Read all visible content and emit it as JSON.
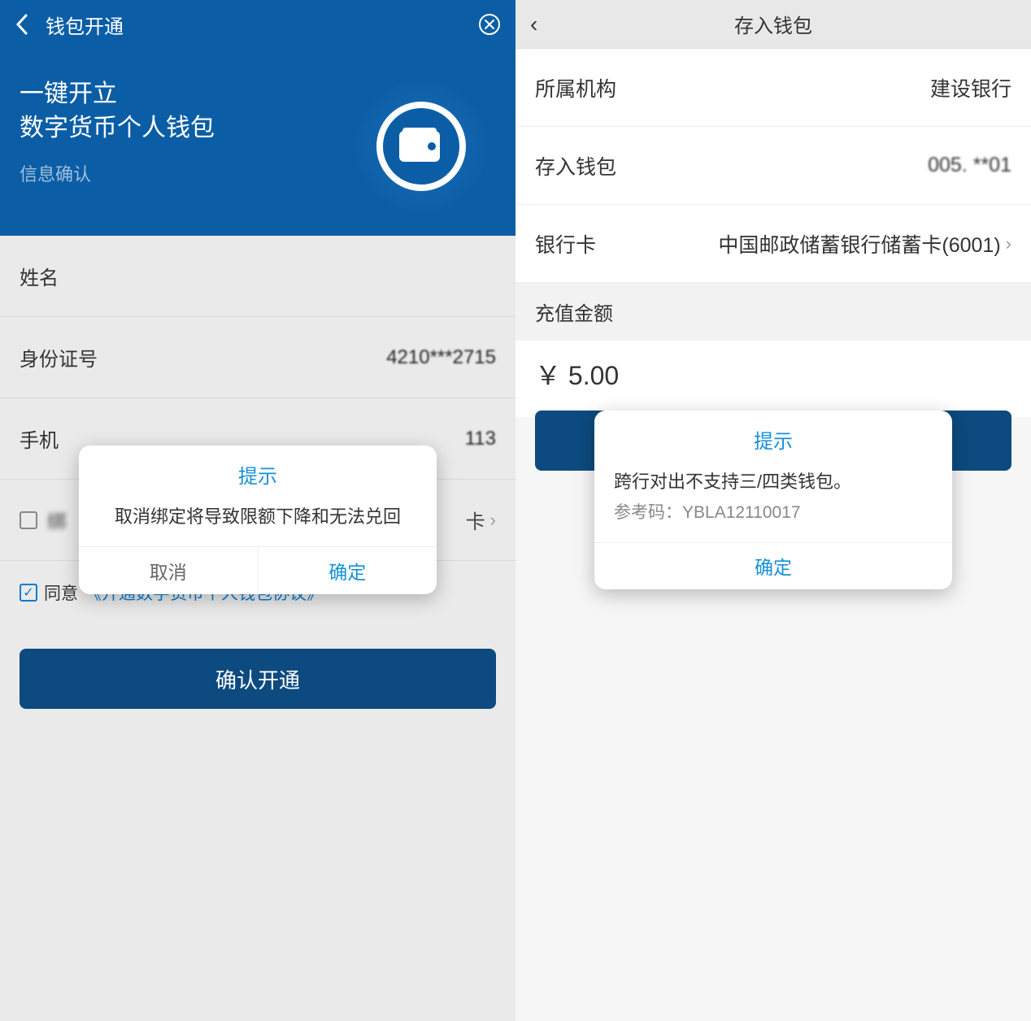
{
  "left": {
    "nav_title": "钱包开通",
    "hero_line1": "一键开立",
    "hero_line2": "数字货币个人钱包",
    "hero_sub": "信息确认",
    "fields": {
      "name_label": "姓名",
      "id_label": "身份证号",
      "id_value": "4210***2715",
      "phone_label": "手机",
      "phone_value": "113",
      "card_row_suffix": "卡",
      "agree_text": "同意",
      "agreement_link": "《开通数字货币个人钱包协议》"
    },
    "submit_label": "确认开通",
    "dialog": {
      "title": "提示",
      "body": "取消绑定将导致限额下降和无法兑回",
      "cancel": "取消",
      "ok": "确定"
    }
  },
  "right": {
    "nav_title": "存入钱包",
    "rows": {
      "org_label": "所属机构",
      "org_value": "建设银行",
      "wallet_label": "存入钱包",
      "wallet_value": "005. **01",
      "card_label": "银行卡",
      "card_value": "中国邮政储蓄银行储蓄卡(6001)"
    },
    "amount_label": "充值金额",
    "amount_value": "￥ 5.00",
    "dialog": {
      "title": "提示",
      "body": "跨行对出不支持三/四类钱包。",
      "ref_label": "参考码：",
      "ref_value": "YBLA12110017",
      "ok": "确定"
    }
  },
  "icons": {
    "back": "back-icon",
    "close_circle": "close-circle-icon",
    "wallet": "wallet-icon",
    "chevron_right": "chevron-right-icon",
    "checkbox_checked": "checkbox-checked-icon",
    "checkbox_empty": "checkbox-empty-icon"
  }
}
